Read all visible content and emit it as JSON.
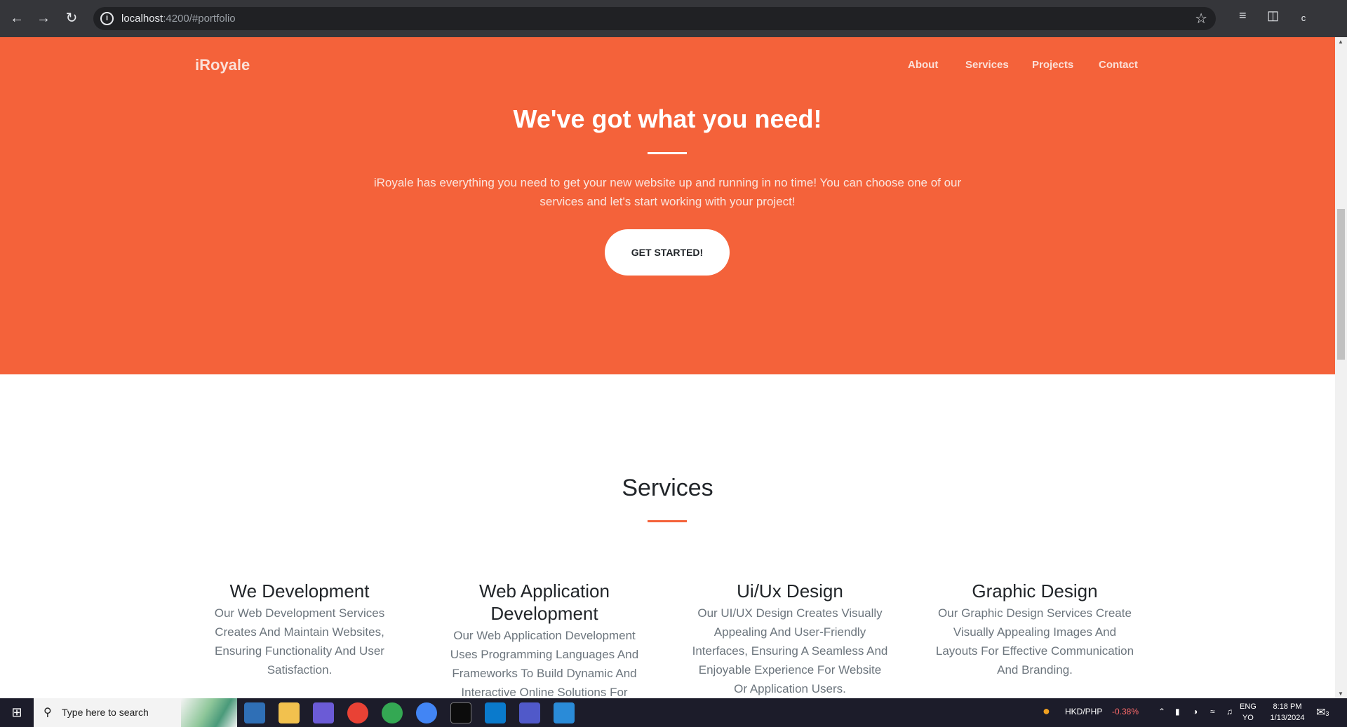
{
  "browser": {
    "url_host": "localhost",
    "url_rest": ":4200/#portfolio",
    "profile_initial": "c"
  },
  "site": {
    "brand": "iRoyale",
    "nav": [
      "About",
      "Services",
      "Projects",
      "Contact"
    ],
    "hero": {
      "title": "We've got what you need!",
      "text": "iRoyale has everything you need to get your new website up and running in no time! You can choose one of our services and let's start working with your project!",
      "cta": "GET STARTED!"
    },
    "services": {
      "title": "Services",
      "items": [
        {
          "title": "We Development",
          "text": "Our Web Development Services Creates And Maintain Websites, Ensuring Functionality And User Satisfaction."
        },
        {
          "title": "Web Application Development",
          "text": "Our Web Application Development Uses Programming Languages And Frameworks To Build Dynamic And Interactive Online Solutions For"
        },
        {
          "title": "Ui/Ux Design",
          "text": "Our UI/UX Design Creates Visually Appealing And User-Friendly Interfaces, Ensuring A Seamless And Enjoyable Experience For Website Or Application Users."
        },
        {
          "title": "Graphic Design",
          "text": "Our Graphic Design Services Create Visually Appealing Images And Layouts For Effective Communication And Branding."
        }
      ]
    }
  },
  "taskbar": {
    "search_placeholder": "Type here to search",
    "ticker_label": "HKD/PHP",
    "ticker_change": "-0.38%",
    "lang_top": "ENG",
    "lang_bottom": "YO",
    "time": "8:18 PM",
    "date": "1/13/2024",
    "notif_count": "3"
  },
  "colors": {
    "accent": "#f4623a",
    "chrome": "#35363a",
    "taskbar": "#1c1c2a"
  }
}
